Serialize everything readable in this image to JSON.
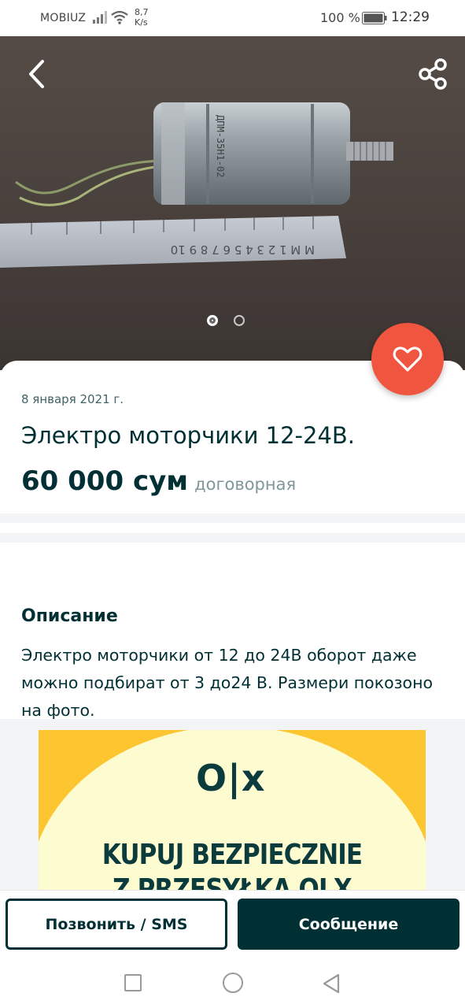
{
  "status_bar": {
    "carrier": "MOBIUZ",
    "net_speed_value": "8,7",
    "net_speed_unit": "K/s",
    "battery_percent": "100 %",
    "time": "12:29"
  },
  "gallery": {
    "image_count": 2,
    "active_index": 0,
    "back_icon": "chevron-left-icon",
    "share_icon": "share-icon",
    "favorite_icon": "heart-icon"
  },
  "listing": {
    "date": "8 января 2021 г.",
    "title": "Электро моторчики 12-24В.",
    "price": "60 000 сум",
    "price_note": "договорная"
  },
  "description": {
    "heading": "Описание",
    "text": "Электро моторчики от 12 до 24В оборот даже можно подбират от 3 до24 В. Размери покозоно на фото."
  },
  "banner": {
    "logo": "O|x",
    "line1": "KUPUJ BEZPIECZNIE",
    "line2": "Z PRZESYŁKĄ OLX"
  },
  "actions": {
    "call_label": "Позвонить / SMS",
    "message_label": "Сообщение"
  },
  "colors": {
    "brand_dark": "#002f34",
    "favorite": "#f0553f",
    "muted": "#7f9799",
    "banner_yellow": "#fdc52f"
  }
}
